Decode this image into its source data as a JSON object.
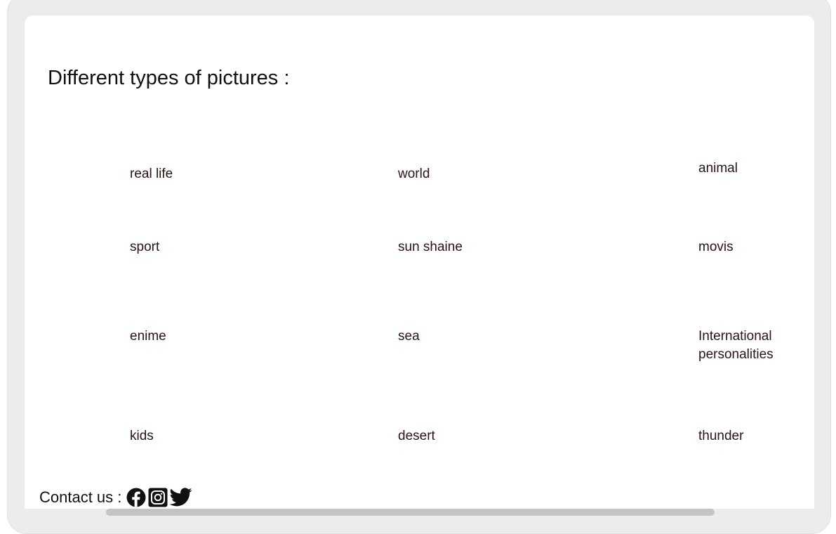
{
  "main": {
    "title": "Different types of pictures :",
    "categories": [
      [
        "real life",
        "world",
        "animal"
      ],
      [
        "sport",
        "sun shaine",
        "movis"
      ],
      [
        "enime",
        "sea",
        "International personalities"
      ],
      [
        "kids",
        "desert",
        "thunder"
      ]
    ]
  },
  "footer": {
    "contact_label": "Contact us :",
    "social": [
      {
        "icon": "facebook-icon"
      },
      {
        "icon": "instagram-icon"
      },
      {
        "icon": "twitter-icon"
      }
    ]
  },
  "colors": {
    "frame": "#ececec",
    "panel": "#ffffff",
    "text": "#2b1414",
    "scrollbar": "#c4c4c4"
  }
}
